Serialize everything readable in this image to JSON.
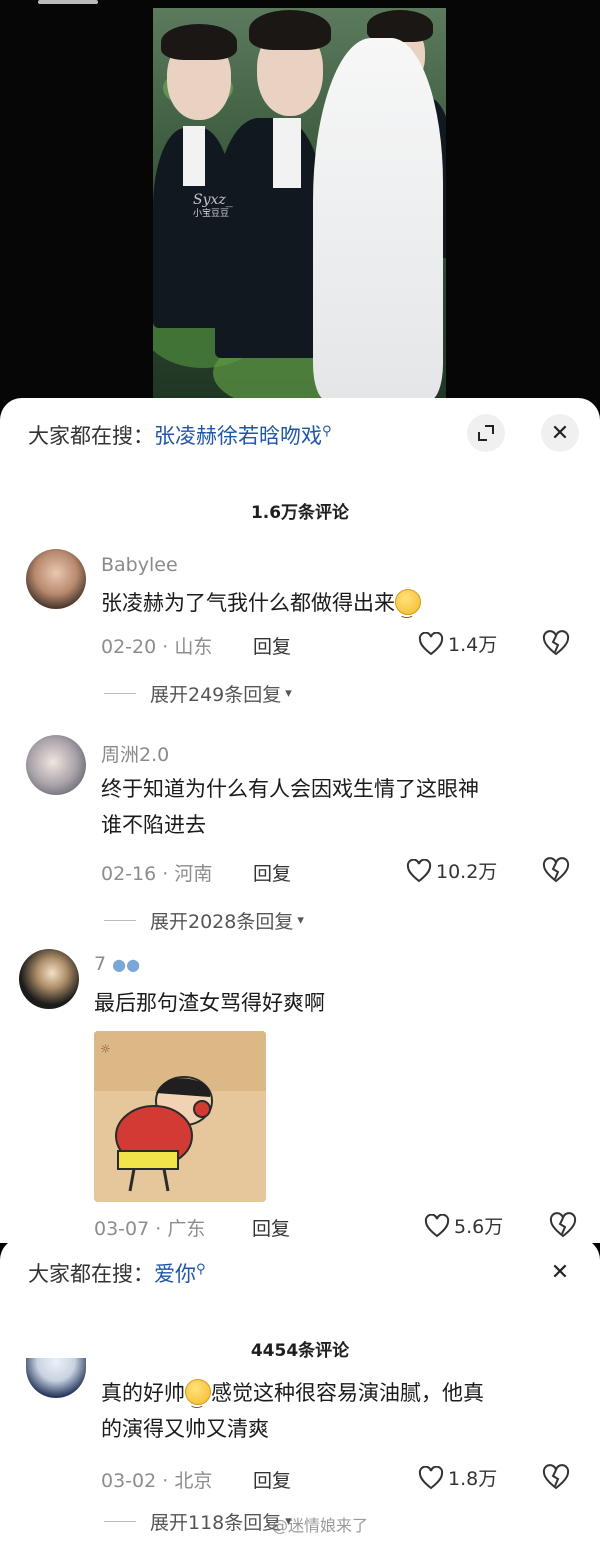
{
  "video": {
    "watermark_main": "Syxz_",
    "watermark_sub": "小宝豆豆"
  },
  "panel1": {
    "search_prefix": "大家都在搜：",
    "search_query": "张凌赫徐若晗吻戏",
    "comment_count": "1.6万条评论",
    "comments": [
      {
        "nickname": "Babylee",
        "text": "张凌赫为了气我什么都做得出来",
        "date": "02-20 · 山东",
        "reply": "回复",
        "likes": "1.4万",
        "expand": "展开249条回复"
      },
      {
        "nickname": "周洲2.0",
        "text_line1": "终于知道为什么有人会因戏生情了这眼神",
        "text_line2": "谁不陷进去",
        "date": "02-16 · 河南",
        "reply": "回复",
        "likes": "10.2万",
        "expand": "展开2028条回复"
      },
      {
        "nickname": "7",
        "text": "最后那句渣女骂得好爽啊",
        "date": "03-07 · 广东",
        "reply": "回复",
        "likes": "5.6万"
      }
    ]
  },
  "panel2": {
    "search_prefix": "大家都在搜：",
    "search_query": "爱你",
    "comment_count": "4454条评论",
    "comment": {
      "text_part1": "真的好帅",
      "text_part2": "感觉这种很容易演油腻，他真",
      "text_line2": "的演得又帅又清爽",
      "date": "03-02 · 北京",
      "reply": "回复",
      "likes": "1.8万",
      "expand": "展开118条回复"
    }
  },
  "site_watermark": "@迷情娘来了",
  "icons": {
    "search_mark": "Q",
    "close": "✕",
    "chevron": "⌄",
    "paw": "🐾"
  }
}
